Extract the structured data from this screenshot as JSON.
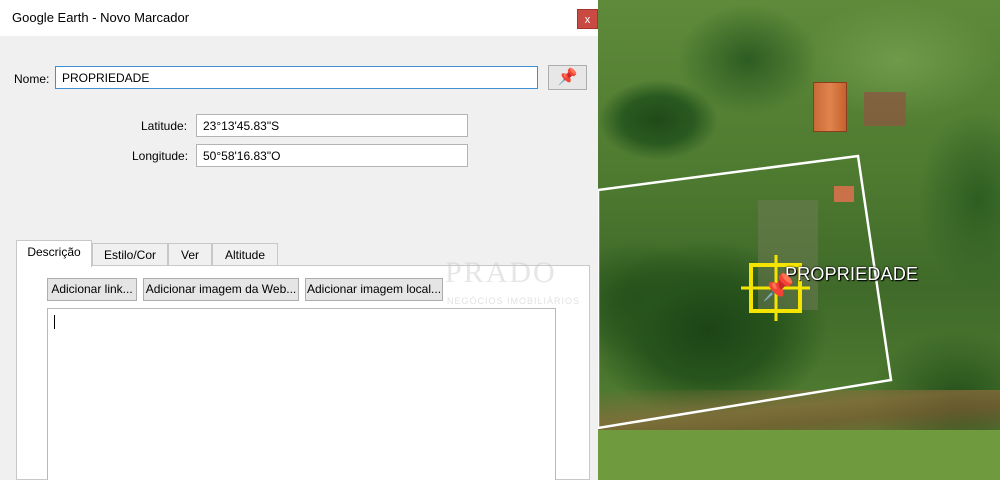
{
  "window": {
    "title": "Google Earth - Novo Marcador",
    "close_glyph": "x"
  },
  "form": {
    "name_label": "Nome:",
    "name_value": "PROPRIEDADE",
    "latitude_label": "Latitude:",
    "latitude_value": "23°13'45.83\"S",
    "longitude_label": "Longitude:",
    "longitude_value": "50°58'16.83\"O",
    "pin_icon": "pushpin-icon"
  },
  "tabs": [
    {
      "label": "Descrição",
      "active": true
    },
    {
      "label": "Estilo/Cor",
      "active": false
    },
    {
      "label": "Ver",
      "active": false
    },
    {
      "label": "Altitude",
      "active": false
    }
  ],
  "description": {
    "buttons": [
      "Adicionar link...",
      "Adicionar imagem da Web...",
      "Adicionar imagem local..."
    ],
    "text": ""
  },
  "map": {
    "placemark_label": "PROPRIEDADE",
    "placemark_icon": "pushpin-icon",
    "highlight_color": "#f5e400",
    "boundary_color": "#ffffff"
  },
  "watermark": {
    "logo": "PRADO",
    "subtitle": "NEGÓCIOS IMOBILIÁRIOS"
  },
  "colors": {
    "close_button": "#c94a43",
    "focus_border": "#3f8fd2"
  }
}
